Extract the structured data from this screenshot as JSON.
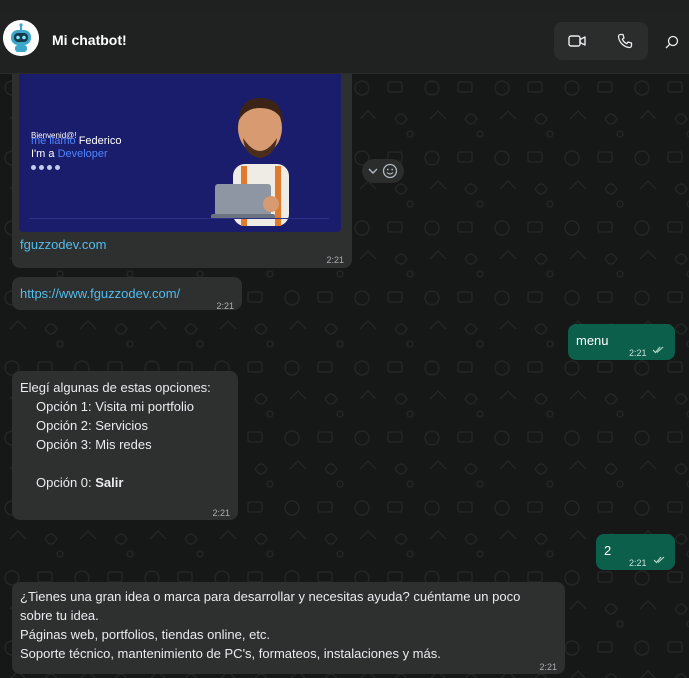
{
  "header": {
    "title": "Mi chatbot!",
    "avatar_icon": "robot-avatar-icon",
    "video_icon": "video-camera-icon",
    "call_icon": "phone-icon",
    "search_icon": "search-icon"
  },
  "preview": {
    "image_text": {
      "line1": "Bienvenid@!",
      "line2a": "me llamo",
      "line2b": "Federico",
      "line3a": "I'm a",
      "line3b": "Developer"
    },
    "site": "fguzzodev.com",
    "time": "2:21"
  },
  "messages": [
    {
      "id": "link",
      "text": "https://www.fguzzodev.com/",
      "time": "2:21"
    },
    {
      "id": "menu",
      "text": "menu",
      "time": "2:21"
    },
    {
      "id": "options",
      "intro": "Elegí algunas de estas opciones:",
      "option1": "Opción 1: Visita mi portfolio",
      "option2": "Opción 2: Servicios",
      "option3": "Opción 3: Mis redes",
      "option0_prefix": "Opción 0: ",
      "option0_bold": "Salir",
      "time": "2:21"
    },
    {
      "id": "two",
      "text": "2",
      "time": "2:21"
    },
    {
      "id": "services",
      "line1": "¿Tienes una gran idea o marca para desarrollar y necesitas ayuda? cuéntame un poco",
      "line2": "sobre tu idea.",
      "line3": "Páginas web, portfolios, tiendas online, etc.",
      "line4": "Soporte técnico, mantenimiento de PC's, formateos, instalaciones y más.",
      "time": "2:21"
    }
  ],
  "colors": {
    "outgoing": "#0c5f4a",
    "incoming": "#2e2f2f",
    "link": "#53bdeb",
    "background": "#161717"
  }
}
